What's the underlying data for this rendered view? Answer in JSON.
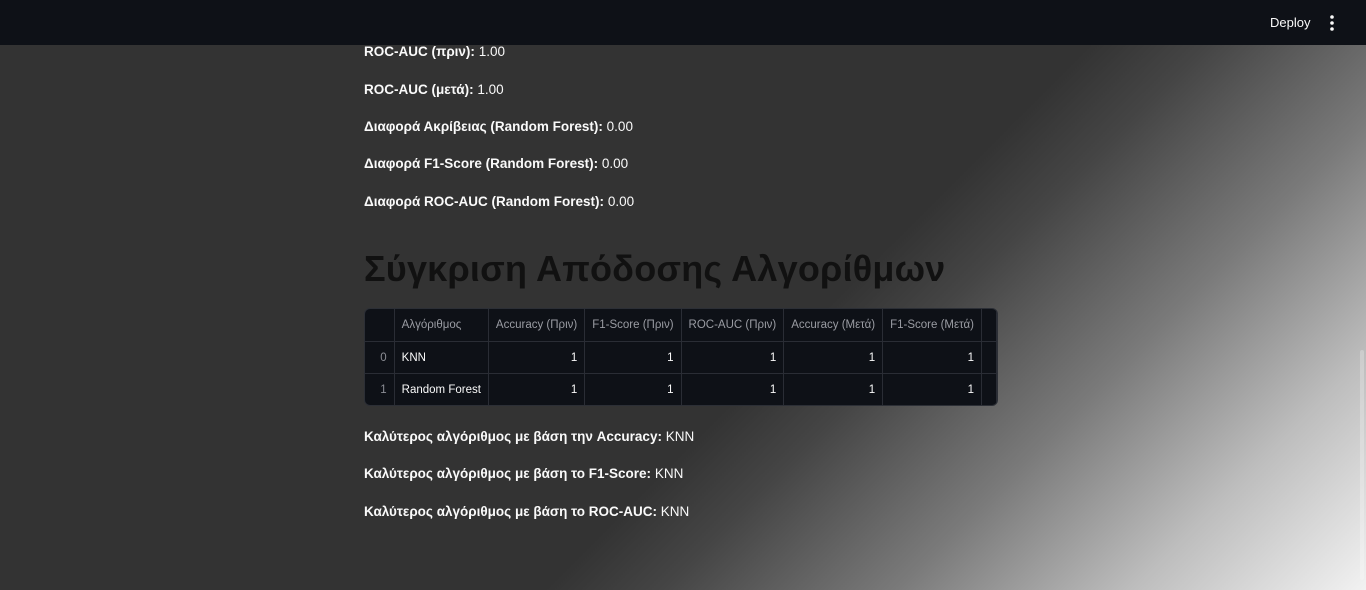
{
  "header": {
    "deploy_label": "Deploy",
    "menu_icon": "more-vertical-icon"
  },
  "metrics": [
    {
      "label": "ROC-AUC (πριν):",
      "value": "1.00"
    },
    {
      "label": "ROC-AUC (μετά):",
      "value": "1.00"
    },
    {
      "label": "Διαφορά Ακρίβειας (Random Forest):",
      "value": "0.00"
    },
    {
      "label": "Διαφορά F1-Score (Random Forest):",
      "value": "0.00"
    },
    {
      "label": "Διαφορά ROC-AUC (Random Forest):",
      "value": "0.00"
    }
  ],
  "section_title": "Σύγκριση Απόδοσης Αλγορίθμων",
  "table": {
    "columns": [
      "",
      "Αλγόριθμος",
      "Accuracy (Πριν)",
      "F1-Score (Πριν)",
      "ROC-AUC (Πριν)",
      "Accuracy (Μετά)",
      "F1-Score (Μετά)"
    ],
    "rows": [
      {
        "index": "0",
        "algorithm": "KNN",
        "values": [
          "1",
          "1",
          "1",
          "1",
          "1"
        ]
      },
      {
        "index": "1",
        "algorithm": "Random Forest",
        "values": [
          "1",
          "1",
          "1",
          "1",
          "1"
        ]
      }
    ]
  },
  "best": [
    {
      "label": "Καλύτερος αλγόριθμος με βάση την Accuracy:",
      "value": "KNN"
    },
    {
      "label": "Καλύτερος αλγόριθμος με βάση το F1-Score:",
      "value": "KNN"
    },
    {
      "label": "Καλύτερος αλγόριθμος με βάση το ROC-AUC:",
      "value": "KNN"
    }
  ]
}
